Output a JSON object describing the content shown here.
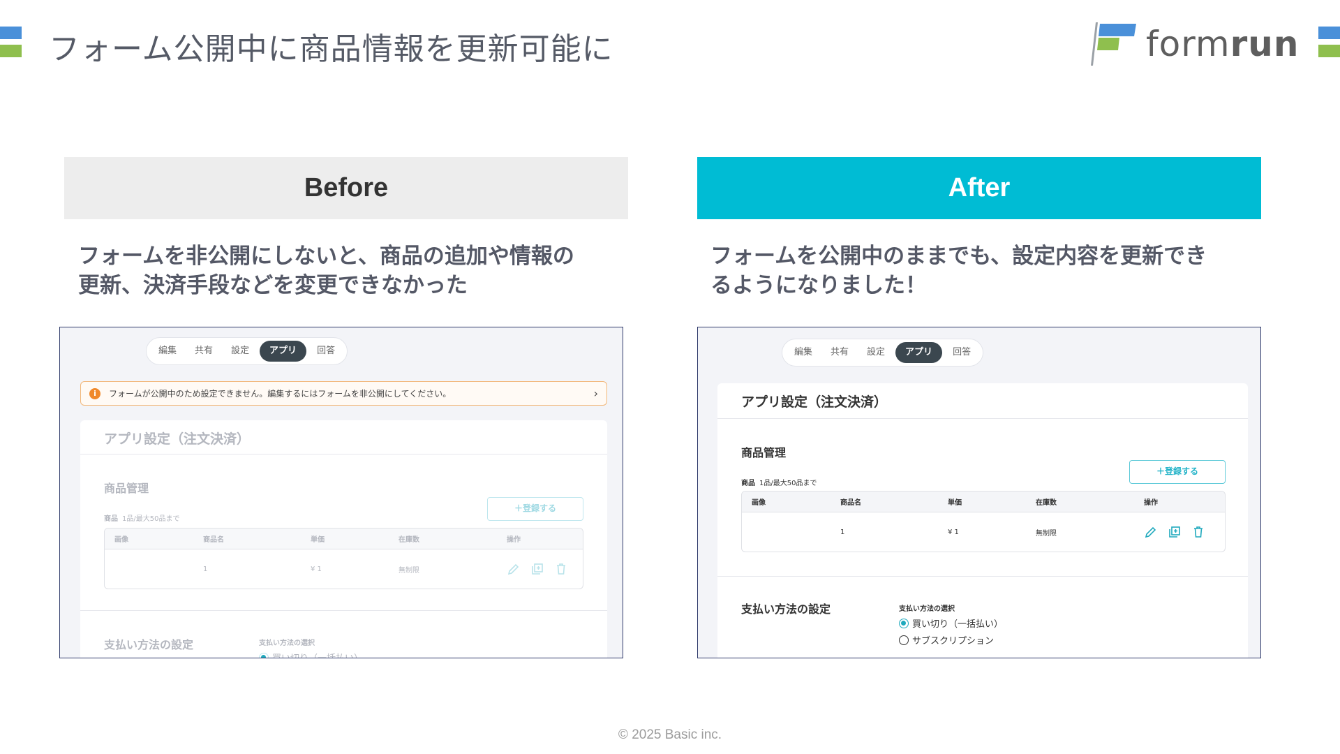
{
  "slide": {
    "title": "フォーム公開中に商品情報を更新可能に",
    "logo_text_light": "form",
    "logo_text_bold": "run",
    "footer": "© 2025 Basic inc."
  },
  "before": {
    "heading": "Before",
    "description_line1": "フォームを非公開にしないと、商品の追加や情報の",
    "description_line2": "更新、決済手段などを変更できなかった",
    "screenshot": {
      "tabs": [
        "編集",
        "共有",
        "設定",
        "アプリ",
        "回答"
      ],
      "active_tab": "アプリ",
      "warning_text": "フォームが公開中のため設定できません。編集するにはフォームを非公開にしてください。",
      "card_title": "アプリ設定（注文決済）",
      "section_title": "商品管理",
      "sub_label_bold": "商品",
      "sub_label": "1品/最大50品まで",
      "register_button": "＋登録する",
      "table_headers": [
        "画像",
        "商品名",
        "単価",
        "在庫数",
        "操作"
      ],
      "table_row": [
        "",
        "1",
        "¥ 1",
        "無制限"
      ],
      "payment_title": "支払い方法の設定",
      "payment_sub": "支払い方法の選択",
      "payment_option_partial": "買い切り（一括払い）"
    }
  },
  "after": {
    "heading": "After",
    "description_line1": "フォームを公開中のままでも、設定内容を更新でき",
    "description_line2": "るようになりました！",
    "screenshot": {
      "tabs": [
        "編集",
        "共有",
        "設定",
        "アプリ",
        "回答"
      ],
      "active_tab": "アプリ",
      "card_title": "アプリ設定（注文決済）",
      "section_title": "商品管理",
      "sub_label_bold": "商品",
      "sub_label": "1品/最大50品まで",
      "register_button": "＋登録する",
      "table_headers": [
        "画像",
        "商品名",
        "単価",
        "在庫数",
        "操作"
      ],
      "table_row": [
        "",
        "1",
        "¥ 1",
        "無制限"
      ],
      "payment_title": "支払い方法の設定",
      "payment_sub": "支払い方法の選択",
      "payment_options": [
        "買い切り（一括払い）",
        "サブスクリプション"
      ],
      "selected_option": "買い切り（一括払い）"
    }
  },
  "colors": {
    "accent": "#00bcd4",
    "before_header_bg": "#ededed",
    "warning_orange": "#f0892b",
    "frame_border": "#2f3a6b",
    "logo_blue": "#4a90d9",
    "logo_green": "#8fbf4e"
  },
  "icons": [
    "info-icon",
    "chevron-right-icon",
    "edit-pencil-icon",
    "duplicate-icon",
    "trash-icon",
    "formrun-flag-logo"
  ]
}
